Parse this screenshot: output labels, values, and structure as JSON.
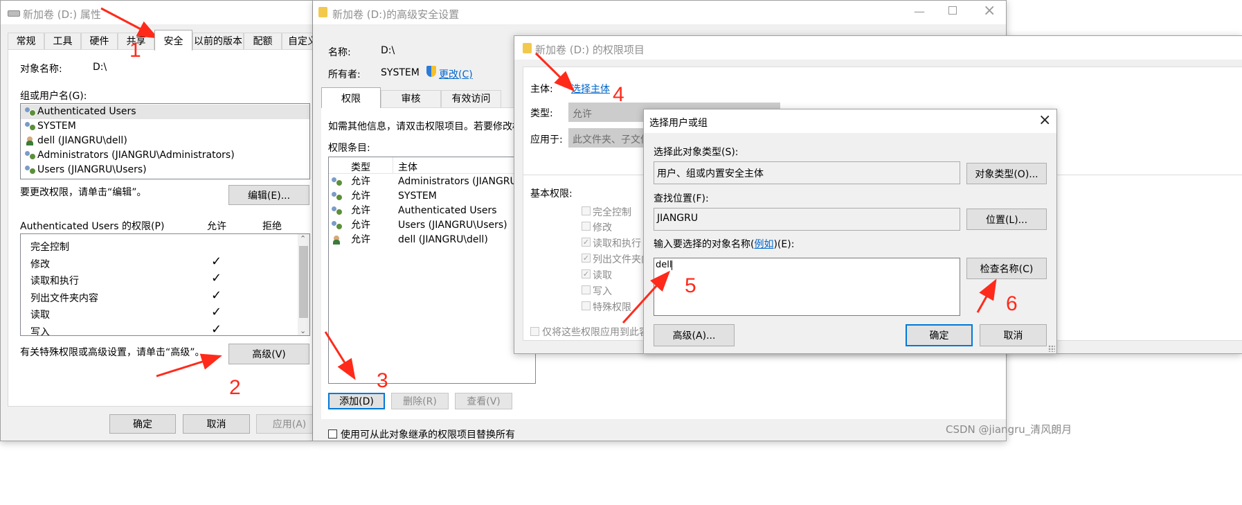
{
  "colors": {
    "accent": "#0078d7",
    "annotation": "#ff2a1a",
    "link": "#0066cc"
  },
  "props_window": {
    "title": "新加卷 (D:) 属性",
    "tabs": [
      "常规",
      "工具",
      "硬件",
      "共享",
      "安全",
      "以前的版本",
      "配额",
      "自定义"
    ],
    "active_tab": "安全",
    "object_name_label": "对象名称:",
    "object_name_value": "D:\\",
    "groups_label": "组或用户名(G):",
    "groups": [
      "Authenticated Users",
      "SYSTEM",
      "dell (JIANGRU\\dell)",
      "Administrators (JIANGRU\\Administrators)",
      "Users (JIANGRU\\Users)"
    ],
    "change_hint": "要更改权限，请单击“编辑”。",
    "edit_button": "编辑(E)...",
    "perm_title": "Authenticated Users 的权限(P)",
    "allow_header": "允许",
    "deny_header": "拒绝",
    "permissions": [
      {
        "name": "完全控制",
        "allow": ""
      },
      {
        "name": "修改",
        "allow": "✓"
      },
      {
        "name": "读取和执行",
        "allow": "✓"
      },
      {
        "name": "列出文件夹内容",
        "allow": "✓"
      },
      {
        "name": "读取",
        "allow": "✓"
      },
      {
        "name": "写入",
        "allow": "✓"
      }
    ],
    "advanced_hint": "有关特殊权限或高级设置，请单击“高级”。",
    "advanced_button": "高级(V)",
    "ok_button": "确定",
    "cancel_button": "取消",
    "apply_button": "应用(A)"
  },
  "adv_window": {
    "title": "新加卷 (D:)的高级安全设置",
    "name_label": "名称:",
    "name_value": "D:\\",
    "owner_label": "所有者:",
    "owner_value": "SYSTEM",
    "change_link": "更改(C)",
    "tabs": [
      "权限",
      "审核",
      "有效访问"
    ],
    "info_text": "如需其他信息，请双击权限项目。若要修改权限",
    "entries_label": "权限条目:",
    "col_type": "类型",
    "col_principal": "主体",
    "entries": [
      {
        "type": "允许",
        "principal": "Administrators (JIANGRU\\Administrators)"
      },
      {
        "type": "允许",
        "principal": "SYSTEM"
      },
      {
        "type": "允许",
        "principal": "Authenticated Users"
      },
      {
        "type": "允许",
        "principal": "Users (JIANGRU\\Users)"
      },
      {
        "type": "允许",
        "principal": "dell (JIANGRU\\dell)"
      }
    ],
    "add_button": "添加(D)",
    "remove_button": "删除(R)",
    "view_button": "查看(V)",
    "replace_label": "使用可从此对象继承的权限项目替换所有"
  },
  "perm_entry_window": {
    "title": "新加卷 (D:) 的权限项目",
    "principal_label": "主体:",
    "principal_link": "选择主体",
    "type_label": "类型:",
    "type_value": "允许",
    "applies_label": "应用于:",
    "applies_value": "此文件夹、子文件",
    "basic_perms_label": "基本权限:",
    "basic_perms": [
      {
        "name": "完全控制",
        "checked": ""
      },
      {
        "name": "修改",
        "checked": ""
      },
      {
        "name": "读取和执行",
        "checked": "✓"
      },
      {
        "name": "列出文件夹内",
        "checked": "✓"
      },
      {
        "name": "读取",
        "checked": "✓"
      },
      {
        "name": "写入",
        "checked": ""
      },
      {
        "name": "特殊权限",
        "checked": ""
      }
    ],
    "only_apply_label": "仅将这些权限应用到此容"
  },
  "select_dialog": {
    "title": "选择用户或组",
    "object_type_label": "选择此对象类型(S):",
    "object_type_value": "用户、组或内置安全主体",
    "object_type_button": "对象类型(O)...",
    "location_label": "查找位置(F):",
    "location_value": "JIANGRU",
    "location_button": "位置(L)...",
    "enter_name_label": "输入要选择的对象名称(",
    "example_link": "例如",
    "enter_name_suffix": ")(E):",
    "name_input_value": "dell",
    "check_names_button": "检查名称(C)",
    "advanced_button": "高级(A)...",
    "ok_button": "确定",
    "cancel_button": "取消"
  },
  "annotations": [
    "1",
    "2",
    "3",
    "4",
    "5",
    "6"
  ],
  "watermark": "CSDN @jiangru_清风朗月"
}
